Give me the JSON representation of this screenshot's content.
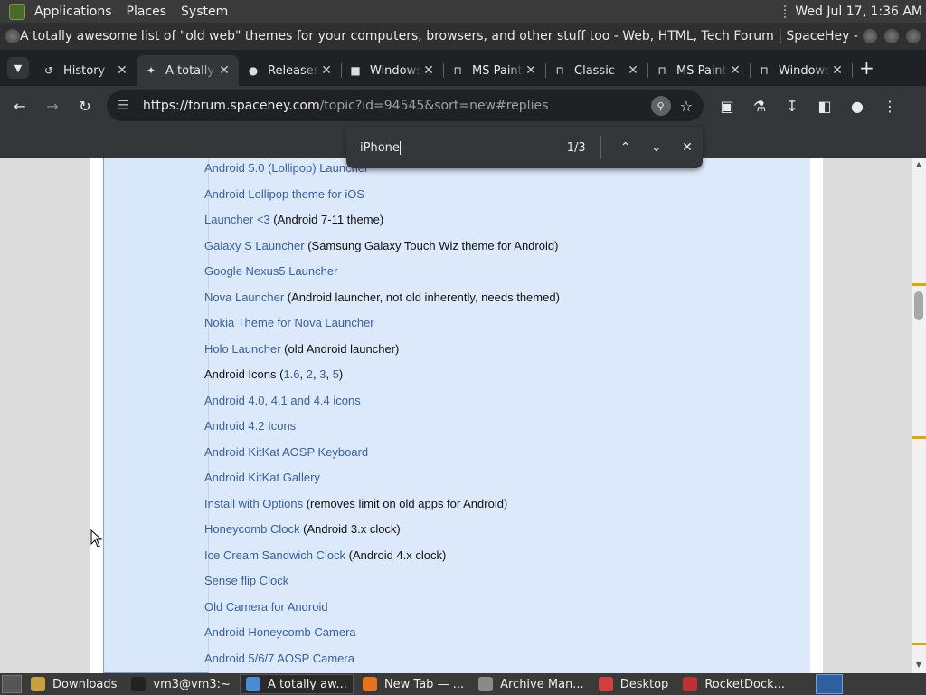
{
  "top_panel": {
    "menus": [
      "Applications",
      "Places",
      "System"
    ],
    "clock": "Wed Jul 17,  1:36 AM"
  },
  "window": {
    "title": "A totally awesome list of \"old web\" themes for your computers, browsers, and other stuff too - Web, HTML, Tech Forum | SpaceHey - Chromium"
  },
  "tabs": [
    {
      "label": "History",
      "icon": "history-icon"
    },
    {
      "label": "A totally awesome list",
      "icon": "spacehey-icon",
      "active": true
    },
    {
      "label": "Releases",
      "icon": "github-icon"
    },
    {
      "label": "Windows",
      "icon": "windows-icon"
    },
    {
      "label": "MS Paint",
      "icon": "archive-icon"
    },
    {
      "label": "Classic",
      "icon": "archive-icon"
    },
    {
      "label": "MS Paint",
      "icon": "archive-icon"
    },
    {
      "label": "Windows",
      "icon": "archive-icon"
    }
  ],
  "toolbar": {
    "url_host": "https://forum.spacehey.com",
    "url_rest": "/topic?id=94545&sort=new#replies"
  },
  "find_bar": {
    "query": "iPhone",
    "count": "1/3"
  },
  "content": {
    "items": [
      {
        "link": "Android 5.0 (Lollipop) Launcher",
        "note": ""
      },
      {
        "link": "Android Lollipop theme for iOS",
        "note": ""
      },
      {
        "link": "Launcher <3",
        "note": " (Android 7-11 theme)"
      },
      {
        "link": "Galaxy S Launcher",
        "note": " (Samsung Galaxy Touch Wiz theme for Android)"
      },
      {
        "link": "Google Nexus5 Launcher",
        "note": ""
      },
      {
        "link": "Nova Launcher",
        "note": " (Android launcher, not old inherently, needs themed)"
      },
      {
        "link": "Nokia Theme for Nova Launcher",
        "note": ""
      },
      {
        "link": "Holo Launcher",
        "note": " (old Android launcher)"
      },
      {
        "link": "",
        "note": "",
        "text": "Android Icons (",
        "sublinks": [
          "1.6",
          "2",
          "3",
          "5"
        ],
        "text_end": ")"
      },
      {
        "link": "Android 4.0, 4.1 and 4.4 icons",
        "note": ""
      },
      {
        "link": "Android 4.2 Icons",
        "note": ""
      },
      {
        "link": "Android KitKat AOSP Keyboard",
        "note": ""
      },
      {
        "link": "Android KitKat Gallery",
        "note": ""
      },
      {
        "link": "Install with Options",
        "note": " (removes limit on old apps for Android)"
      },
      {
        "link": "Honeycomb Clock",
        "note": " (Android 3.x clock)"
      },
      {
        "link": "Ice Cream Sandwich Clock",
        "note": " (Android 4.x clock)"
      },
      {
        "link": "Sense flip Clock",
        "note": ""
      },
      {
        "link": "Old Camera for Android",
        "note": ""
      },
      {
        "link": "Android Honeycomb Camera",
        "note": ""
      },
      {
        "link": "Android 5/6/7 AOSP Camera",
        "note": ""
      }
    ]
  },
  "taskbar": {
    "items": [
      {
        "label": "Downloads",
        "icon": "folder-icon",
        "color": "#c8a040"
      },
      {
        "label": "vm3@vm3:~",
        "icon": "terminal-icon",
        "color": "#222222"
      },
      {
        "label": "A totally aw...",
        "icon": "chromium-icon",
        "color": "#4a8bd6",
        "active": true
      },
      {
        "label": "New Tab — ...",
        "icon": "firefox-icon",
        "color": "#e8711c"
      },
      {
        "label": "Archive Man...",
        "icon": "archive-manager-icon",
        "color": "#8a8a8a"
      },
      {
        "label": "Desktop",
        "icon": "desktop-pin-icon",
        "color": "#d04040"
      },
      {
        "label": "RocketDock...",
        "icon": "rocketdock-icon",
        "color": "#c03030"
      }
    ]
  }
}
